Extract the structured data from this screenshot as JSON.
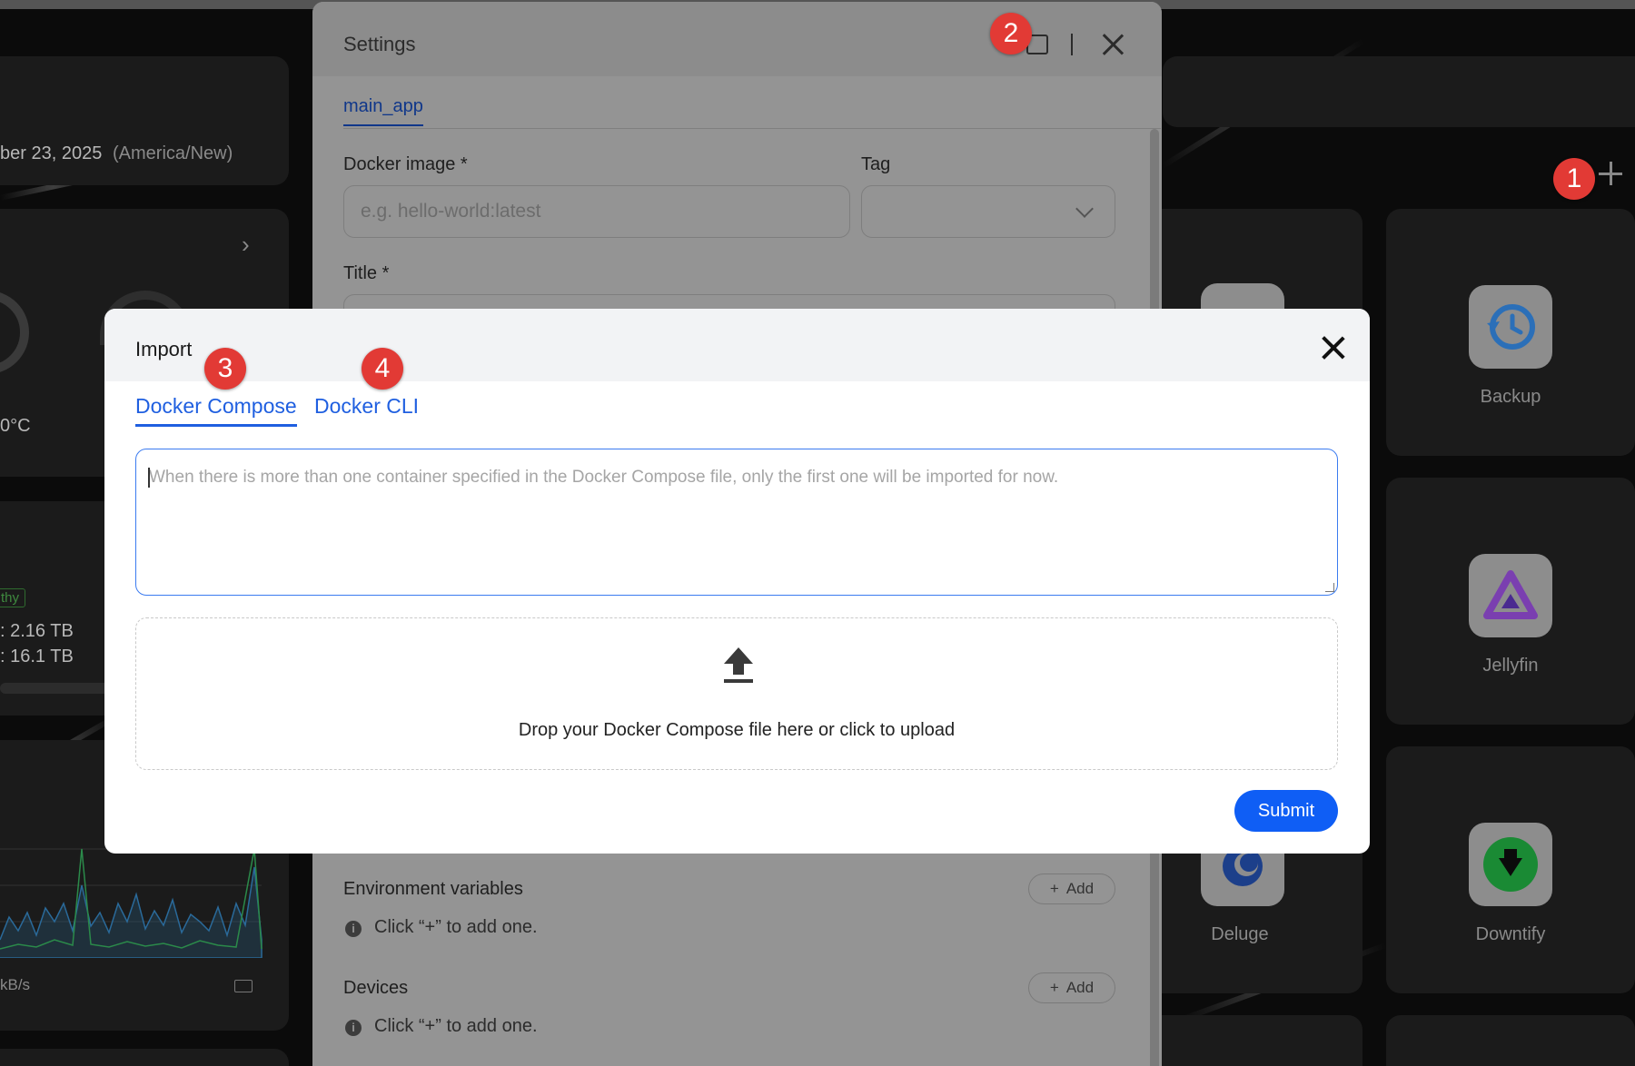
{
  "background": {
    "date_text": "ber 23, 2025",
    "timezone": "(America/New)",
    "temperature": "0°C",
    "health_tag": "thy",
    "storage_used": ": 2.16 TB",
    "storage_total": ": 16.1 TB",
    "network_unit": "kB/s",
    "apps": [
      {
        "label": "Backup",
        "icon": "backup-icon"
      },
      {
        "label": "Jellyfin",
        "icon": "jellyfin-icon"
      },
      {
        "label": "Deluge",
        "icon": "deluge-icon"
      },
      {
        "label": "Downtify",
        "icon": "downtify-icon"
      }
    ]
  },
  "settings": {
    "title": "Settings",
    "tab": "main_app",
    "docker_image_label": "Docker image *",
    "docker_image_placeholder": "e.g. hello-world:latest",
    "tag_label": "Tag",
    "title_label": "Title *",
    "env_label": "Environment variables",
    "env_add": "Add",
    "env_hint": "Click “+” to add one.",
    "devices_label": "Devices",
    "devices_add": "Add",
    "devices_hint": "Click “+” to add one."
  },
  "markers": [
    "1",
    "2",
    "3",
    "4"
  ],
  "import": {
    "title": "Import",
    "tabs": [
      {
        "label": "Docker Compose",
        "active": true
      },
      {
        "label": "Docker CLI",
        "active": false
      }
    ],
    "textarea_placeholder": "When there is more than one container specified in the Docker Compose file, only the first one will be imported for now.",
    "drop_text": "Drop your Docker Compose file here or click to upload",
    "submit": "Submit"
  },
  "colors": {
    "accent": "#0f5ef5",
    "tab_blue": "#1f5fe0",
    "marker_red": "#e23a35"
  }
}
